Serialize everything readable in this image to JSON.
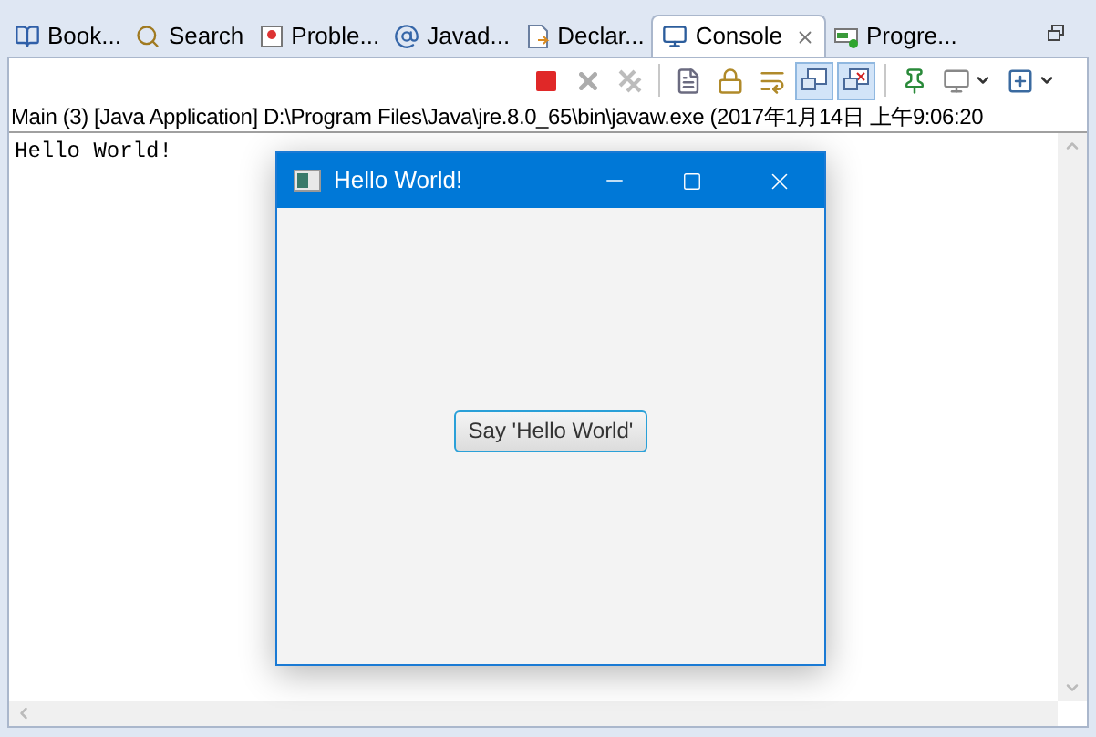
{
  "tabs": [
    {
      "label": "Book...",
      "kind": "book",
      "selected": false,
      "closable": false
    },
    {
      "label": "Search",
      "kind": "search",
      "selected": false,
      "closable": false
    },
    {
      "label": "Proble...",
      "kind": "problems",
      "selected": false,
      "closable": false
    },
    {
      "label": "Javad...",
      "kind": "at",
      "selected": false,
      "closable": false
    },
    {
      "label": "Declar...",
      "kind": "declaration",
      "selected": false,
      "closable": false
    },
    {
      "label": "Console",
      "kind": "console",
      "selected": true,
      "closable": true
    },
    {
      "label": "Progre...",
      "kind": "progress",
      "selected": false,
      "closable": false
    }
  ],
  "toolbar": [
    {
      "kind": "terminate",
      "selected": false,
      "disabled": false
    },
    {
      "kind": "remove",
      "selected": false,
      "disabled": true
    },
    {
      "kind": "remove-all",
      "selected": false,
      "disabled": true
    },
    {
      "kind": "separator"
    },
    {
      "kind": "clear",
      "selected": false,
      "disabled": false
    },
    {
      "kind": "scroll-lock",
      "selected": false,
      "disabled": false
    },
    {
      "kind": "word-wrap",
      "selected": false,
      "disabled": false
    },
    {
      "kind": "stdout",
      "selected": true,
      "disabled": false
    },
    {
      "kind": "stderr",
      "selected": true,
      "disabled": false
    },
    {
      "kind": "separator"
    },
    {
      "kind": "pin",
      "selected": false,
      "disabled": false
    },
    {
      "kind": "display",
      "selected": false,
      "disabled": false,
      "dropdown": true
    },
    {
      "kind": "new-console",
      "selected": false,
      "disabled": false,
      "dropdown": true
    }
  ],
  "process_line": "Main (3) [Java Application] D:\\Program Files\\Java\\jre.8.0_65\\bin\\javaw.exe (2017年1月14日 上午9:06:20",
  "console_output": "Hello World!",
  "dialog": {
    "title": "Hello World!",
    "button": "Say 'Hello World'"
  }
}
